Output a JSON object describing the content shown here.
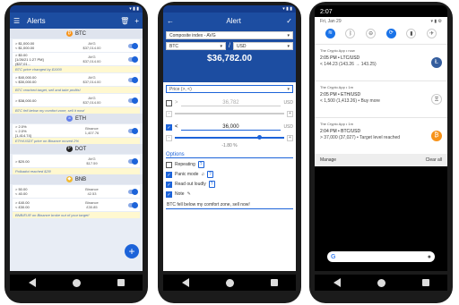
{
  "screen1": {
    "appbar_title": "Alerts",
    "groups": [
      {
        "coin": "BTC",
        "color": "#f7931a",
        "symbol": "₿",
        "alerts": [
          {
            "cond": "> $1,000.00\n< $1,000.00",
            "mid": "AVG\n$37,014.00"
          },
          {
            "cond": "> $0.00\n[1/26/21 1:27 PM] ($37,01...",
            "mid": "AVG\n$37,014.00"
          }
        ],
        "note": "BTC price changed by $1000"
      },
      {
        "coin": "",
        "color": "#f7931a",
        "symbol": "",
        "alerts": [
          {
            "cond": "> $40,000.00\n< $30,000.00",
            "mid": "AVG\n$37,014.00"
          }
        ],
        "note": "BTC reached target, sell and take profits!"
      },
      {
        "coin": "",
        "color": "#f7931a",
        "symbol": "",
        "alerts": [
          {
            "cond": "> $38,000.00",
            "mid": "AVG\n$37,014.00"
          }
        ],
        "note": "BTC fell below my comfort zone, sell it now!"
      },
      {
        "coin": "ETH",
        "color": "#627eea",
        "symbol": "Ξ",
        "alerts": [
          {
            "cond": "> 2.0%\n< 2.0%\n[1,414.74]",
            "mid": "Binance\n1,407.76"
          }
        ],
        "note": "ETH/USDT price on Binance moved 2%"
      },
      {
        "coin": "DOT",
        "color": "#222222",
        "symbol": "P",
        "alerts": [
          {
            "cond": "> $20.00",
            "mid": "AVG\n$17.59"
          }
        ],
        "note": "Polkadot reached $20!"
      },
      {
        "coin": "BNB",
        "color": "#f3ba2f",
        "symbol": "◆",
        "alerts": [
          {
            "cond": "> 50.00\n< 40.00",
            "mid": "Binance\n42.53"
          },
          {
            "cond": "> £40.00\n< £30.00",
            "mid": "Binance\n£30.85"
          }
        ],
        "note": "BNB/EUR on Binance broke out of your target!"
      }
    ]
  },
  "screen2": {
    "appbar_title": "Alert",
    "index_select": "Composite index - AVG",
    "base": "BTC",
    "quote": "USD",
    "price": "$36,782.00",
    "price_input_label": "Price (>, <)",
    "upper_value": "36,782",
    "upper_unit": "USD",
    "lower_op": "<",
    "lower_value": "36,000",
    "lower_unit": "USD",
    "pct": "-1.80 %",
    "options_label": "Options",
    "repeating": "Repeating",
    "panic": "Panic mode",
    "read_out": "Read out loudly",
    "note_label": "Note",
    "note_text": "BTC fell below my comfort zone, sell now!"
  },
  "screen3": {
    "time": "2:07",
    "date": "Fri, Jan 29",
    "notifications": [
      {
        "app": "The Crypto App • now",
        "line1": "2:05 PM • LTC/USD",
        "line2": "< 144.23 (143.26 → 143.25)",
        "coin_color": "#345d9d",
        "coin_symbol": "Ł"
      },
      {
        "app": "The Crypto App • 1m",
        "line1": "2:05 PM • ETH/USD",
        "line2": "< 1,500 (1,413.26) • Buy more",
        "coin_color": "#ffffff",
        "coin_symbol": "Ξ"
      },
      {
        "app": "The Crypto App • 1m",
        "line1": "2:04 PM • BTC/USD",
        "line2": "> 37,000 (37,027) • Target level reached",
        "coin_color": "#f7931a",
        "coin_symbol": "₿"
      }
    ],
    "manage": "Manage",
    "clear_all": "Clear all"
  }
}
